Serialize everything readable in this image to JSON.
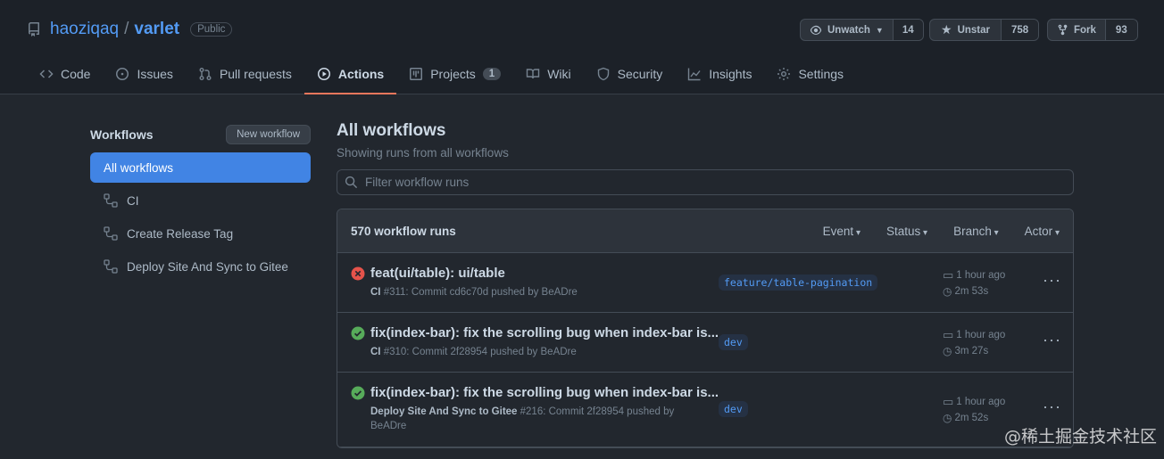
{
  "repo": {
    "owner": "haoziqaq",
    "slash": "/",
    "name": "varlet",
    "visibility": "Public"
  },
  "actions": {
    "watch_label": "Unwatch",
    "watch_count": "14",
    "star_label": "Unstar",
    "star_count": "758",
    "fork_label": "Fork",
    "fork_count": "93"
  },
  "tabs": [
    {
      "label": "Code",
      "icon": "code-icon"
    },
    {
      "label": "Issues",
      "icon": "issue-icon"
    },
    {
      "label": "Pull requests",
      "icon": "pull-request-icon"
    },
    {
      "label": "Actions",
      "icon": "play-icon",
      "active": true
    },
    {
      "label": "Projects",
      "icon": "project-icon",
      "counter": "1"
    },
    {
      "label": "Wiki",
      "icon": "book-icon"
    },
    {
      "label": "Security",
      "icon": "shield-icon"
    },
    {
      "label": "Insights",
      "icon": "graph-icon"
    },
    {
      "label": "Settings",
      "icon": "gear-icon"
    }
  ],
  "sidebar": {
    "title": "Workflows",
    "new_button": "New workflow",
    "items": [
      {
        "label": "All workflows"
      },
      {
        "label": "CI"
      },
      {
        "label": "Create Release Tag"
      },
      {
        "label": "Deploy Site And Sync to Gitee"
      }
    ]
  },
  "main": {
    "title": "All workflows",
    "subtitle": "Showing runs from all workflows",
    "filter_placeholder": "Filter workflow runs",
    "runs_count": "570 workflow runs",
    "filters": [
      "Event",
      "Status",
      "Branch",
      "Actor"
    ],
    "runs": [
      {
        "status": "failure",
        "title": "feat(ui/table): ui/table",
        "workflow": "CI",
        "meta": " #311: Commit cd6c70d pushed by BeADre",
        "branch": "feature/table-pagination",
        "time_ago": "1 hour ago",
        "duration": "2m 53s"
      },
      {
        "status": "success",
        "title": "fix(index-bar): fix the scrolling bug when index-bar is...",
        "workflow": "CI",
        "meta": " #310: Commit 2f28954 pushed by BeADre",
        "branch": "dev",
        "time_ago": "1 hour ago",
        "duration": "3m 27s"
      },
      {
        "status": "success",
        "title": "fix(index-bar): fix the scrolling bug when index-bar is...",
        "workflow": "Deploy Site And Sync to Gitee",
        "meta": " #216: Commit 2f28954 pushed by BeADre",
        "branch": "dev",
        "time_ago": "1 hour ago",
        "duration": "2m 52s"
      }
    ]
  },
  "colors": {
    "accent": "#539bf5",
    "tab_underline": "#ec775c",
    "success": "#57ab5a",
    "failure": "#e5534b",
    "active_workflow": "#4184e4"
  },
  "watermark": "@稀土掘金技术社区"
}
